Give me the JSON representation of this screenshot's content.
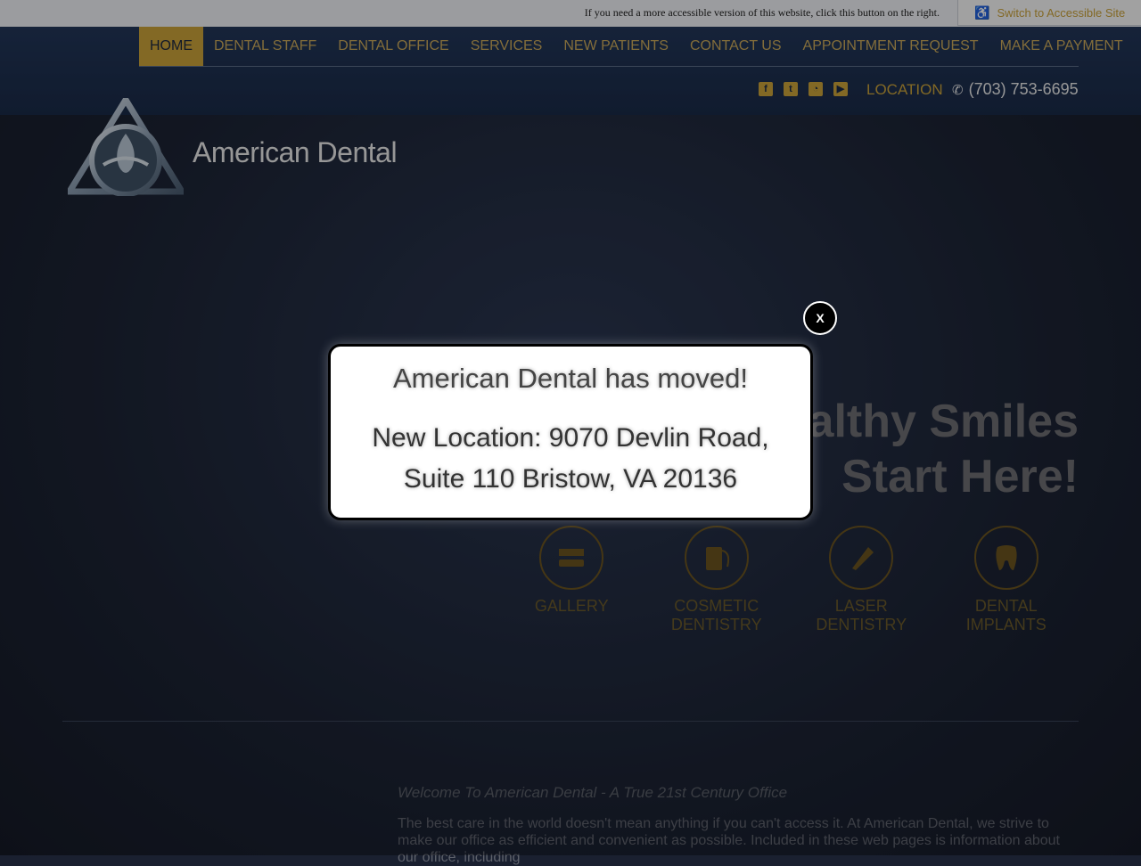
{
  "accessibility": {
    "notice": "If you need a more accessible version of this website, click this button on the right.",
    "button_label": "Switch to Accessible Site",
    "button_icon": "wheelchair-icon"
  },
  "nav": {
    "items": [
      {
        "label": "HOME",
        "active": true
      },
      {
        "label": "DENTAL STAFF"
      },
      {
        "label": "DENTAL OFFICE"
      },
      {
        "label": "SERVICES"
      },
      {
        "label": "NEW PATIENTS"
      },
      {
        "label": "CONTACT US"
      },
      {
        "label": "APPOINTMENT REQUEST"
      },
      {
        "label": "MAKE A PAYMENT"
      }
    ]
  },
  "header": {
    "social_icons": [
      "facebook-icon",
      "twitter-icon",
      "rss-icon",
      "youtube-icon"
    ],
    "location_label": "LOCATION",
    "phone": "(703) 753-6695"
  },
  "brand": {
    "name": "American Dental"
  },
  "hero": {
    "tagline_line1": "Healthy Smiles",
    "tagline_line2": "Start Here!",
    "services": [
      {
        "label": "GALLERY",
        "icon": "toothbrush-icon"
      },
      {
        "label": "COSMETIC DENTISTRY",
        "icon": "floss-icon"
      },
      {
        "label": "LASER DENTISTRY",
        "icon": "toothpaste-icon"
      },
      {
        "label": "DENTAL IMPLANTS",
        "icon": "tooth-icon"
      }
    ]
  },
  "welcome": {
    "heading": "Welcome To American Dental - A True 21st Century Office",
    "body": "The best care in the world doesn't mean anything if you can't access it. At American Dental, we strive to make our office as efficient and convenient as possible. Included in these web pages is information about our office, including"
  },
  "modal": {
    "title": "American Dental has moved!",
    "line1": "New Location: 9070 Devlin Road,",
    "line2": "Suite 110 Bristow, VA 20136",
    "close_label": "X"
  },
  "colors": {
    "accent": "#c9a13a",
    "header_bg": "#1f3152",
    "hero_bg": "#1c2334"
  }
}
